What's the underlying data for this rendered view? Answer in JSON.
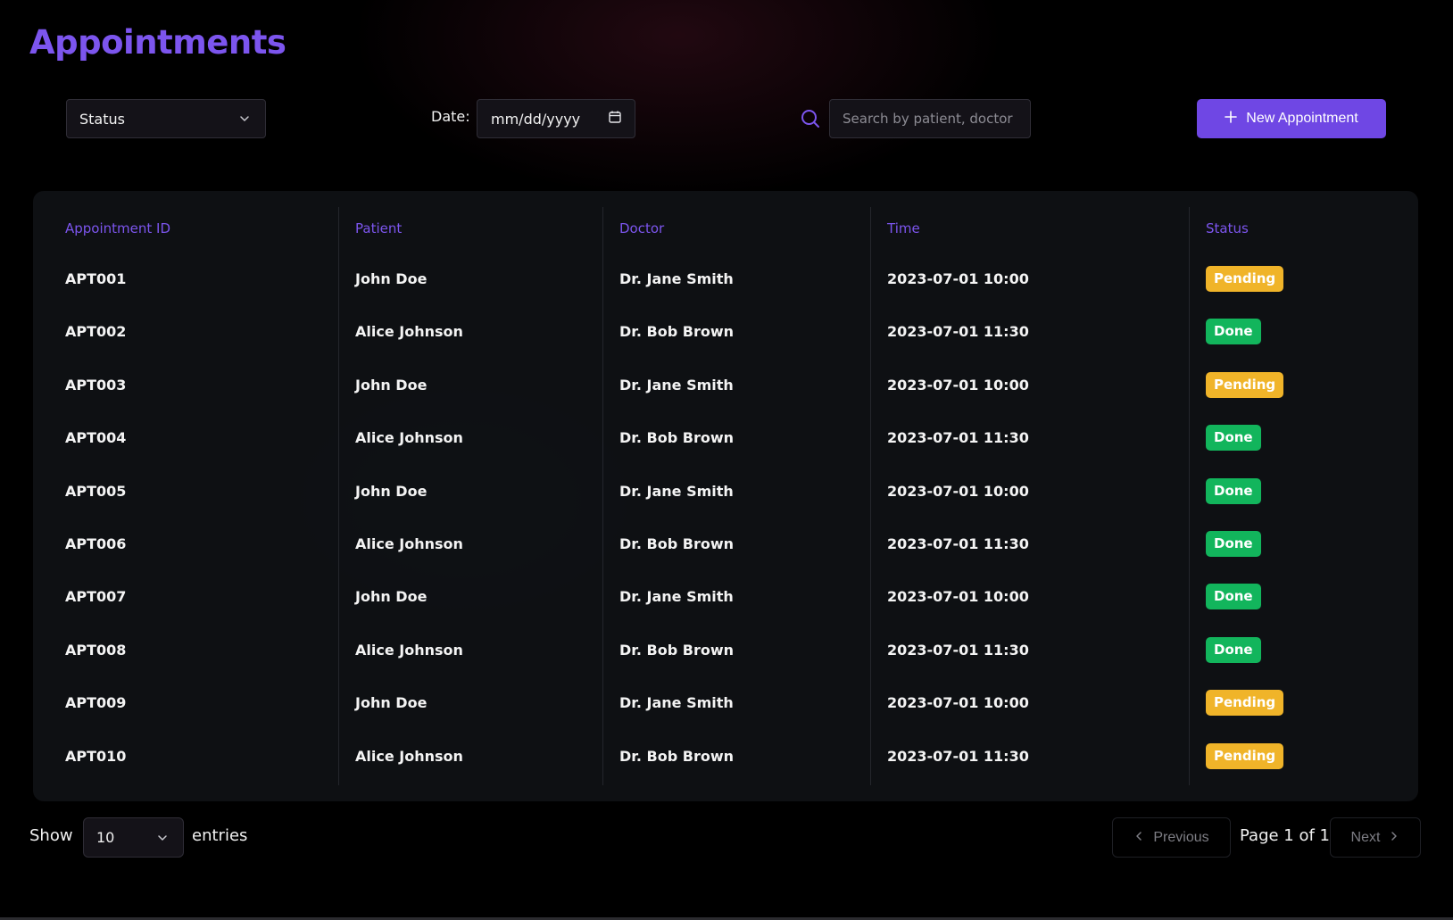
{
  "page": {
    "title": "Appointments"
  },
  "toolbar": {
    "status_filter": "Status",
    "date_label": "Date:",
    "date_placeholder": "mm/dd/yyyy",
    "search_placeholder": "Search by patient, doctor or ID",
    "new_button_label": "New Appointment"
  },
  "table": {
    "columns": [
      "Appointment ID",
      "Patient",
      "Doctor",
      "Time",
      "Status"
    ],
    "rows": [
      {
        "id": "APT001",
        "patient": "John Doe",
        "doctor": "Dr. Jane Smith",
        "time": "2023-07-01 10:00",
        "status": "Pending"
      },
      {
        "id": "APT002",
        "patient": "Alice Johnson",
        "doctor": "Dr. Bob Brown",
        "time": "2023-07-01 11:30",
        "status": "Done"
      },
      {
        "id": "APT003",
        "patient": "John Doe",
        "doctor": "Dr. Jane Smith",
        "time": "2023-07-01 10:00",
        "status": "Pending"
      },
      {
        "id": "APT004",
        "patient": "Alice Johnson",
        "doctor": "Dr. Bob Brown",
        "time": "2023-07-01 11:30",
        "status": "Done"
      },
      {
        "id": "APT005",
        "patient": "John Doe",
        "doctor": "Dr. Jane Smith",
        "time": "2023-07-01 10:00",
        "status": "Done"
      },
      {
        "id": "APT006",
        "patient": "Alice Johnson",
        "doctor": "Dr. Bob Brown",
        "time": "2023-07-01 11:30",
        "status": "Done"
      },
      {
        "id": "APT007",
        "patient": "John Doe",
        "doctor": "Dr. Jane Smith",
        "time": "2023-07-01 10:00",
        "status": "Done"
      },
      {
        "id": "APT008",
        "patient": "Alice Johnson",
        "doctor": "Dr. Bob Brown",
        "time": "2023-07-01 11:30",
        "status": "Done"
      },
      {
        "id": "APT009",
        "patient": "John Doe",
        "doctor": "Dr. Jane Smith",
        "time": "2023-07-01 10:00",
        "status": "Pending"
      },
      {
        "id": "APT010",
        "patient": "Alice Johnson",
        "doctor": "Dr. Bob Brown",
        "time": "2023-07-01 11:30",
        "status": "Pending"
      }
    ]
  },
  "footer": {
    "show_label": "Show",
    "page_size": "10",
    "entries_label": "entries",
    "previous_label": "Previous",
    "page_info": "Page 1 of 1",
    "next_label": "Next"
  },
  "colors": {
    "accent": "#7c55ee",
    "button": "#6f47e4",
    "pending": "#f0b429",
    "done": "#12b55c",
    "background": "#000000"
  },
  "icons": {
    "status_chevron": "chevron-down-icon",
    "date": "calendar-icon",
    "search": "search-icon",
    "new": "plus-icon",
    "previous": "chevron-left-icon",
    "next": "chevron-right-icon"
  }
}
